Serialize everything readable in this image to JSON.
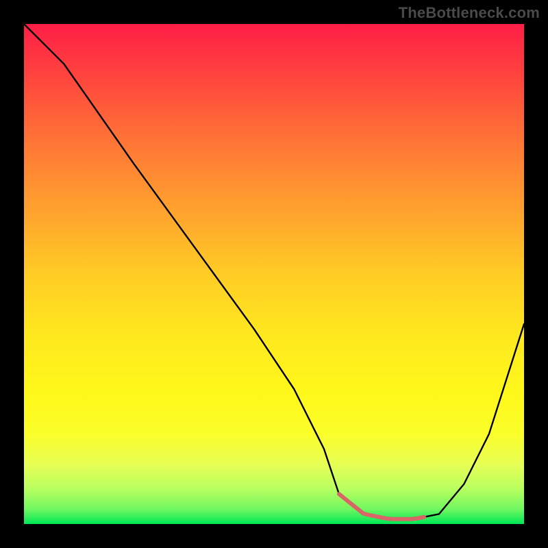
{
  "watermark": "TheBottleneck.com",
  "colors": {
    "background": "#000000",
    "curve": "#000000",
    "highlight": "#D96666",
    "gradient_top": "#FF1E46",
    "gradient_bottom": "#00E756"
  },
  "chart_data": {
    "type": "line",
    "title": "",
    "xlabel": "",
    "ylabel": "",
    "xlim": [
      0,
      100
    ],
    "ylim": [
      0,
      100
    ],
    "x": [
      0,
      3,
      8,
      15,
      22,
      30,
      38,
      46,
      54,
      60,
      63,
      68,
      73,
      78,
      83,
      88,
      93,
      100
    ],
    "values": [
      100,
      97,
      92,
      82,
      72,
      61,
      50,
      39,
      27,
      15,
      6,
      2,
      1,
      1,
      2,
      8,
      18,
      40
    ],
    "highlight_range_xpct": [
      63,
      80
    ],
    "annotations": []
  }
}
